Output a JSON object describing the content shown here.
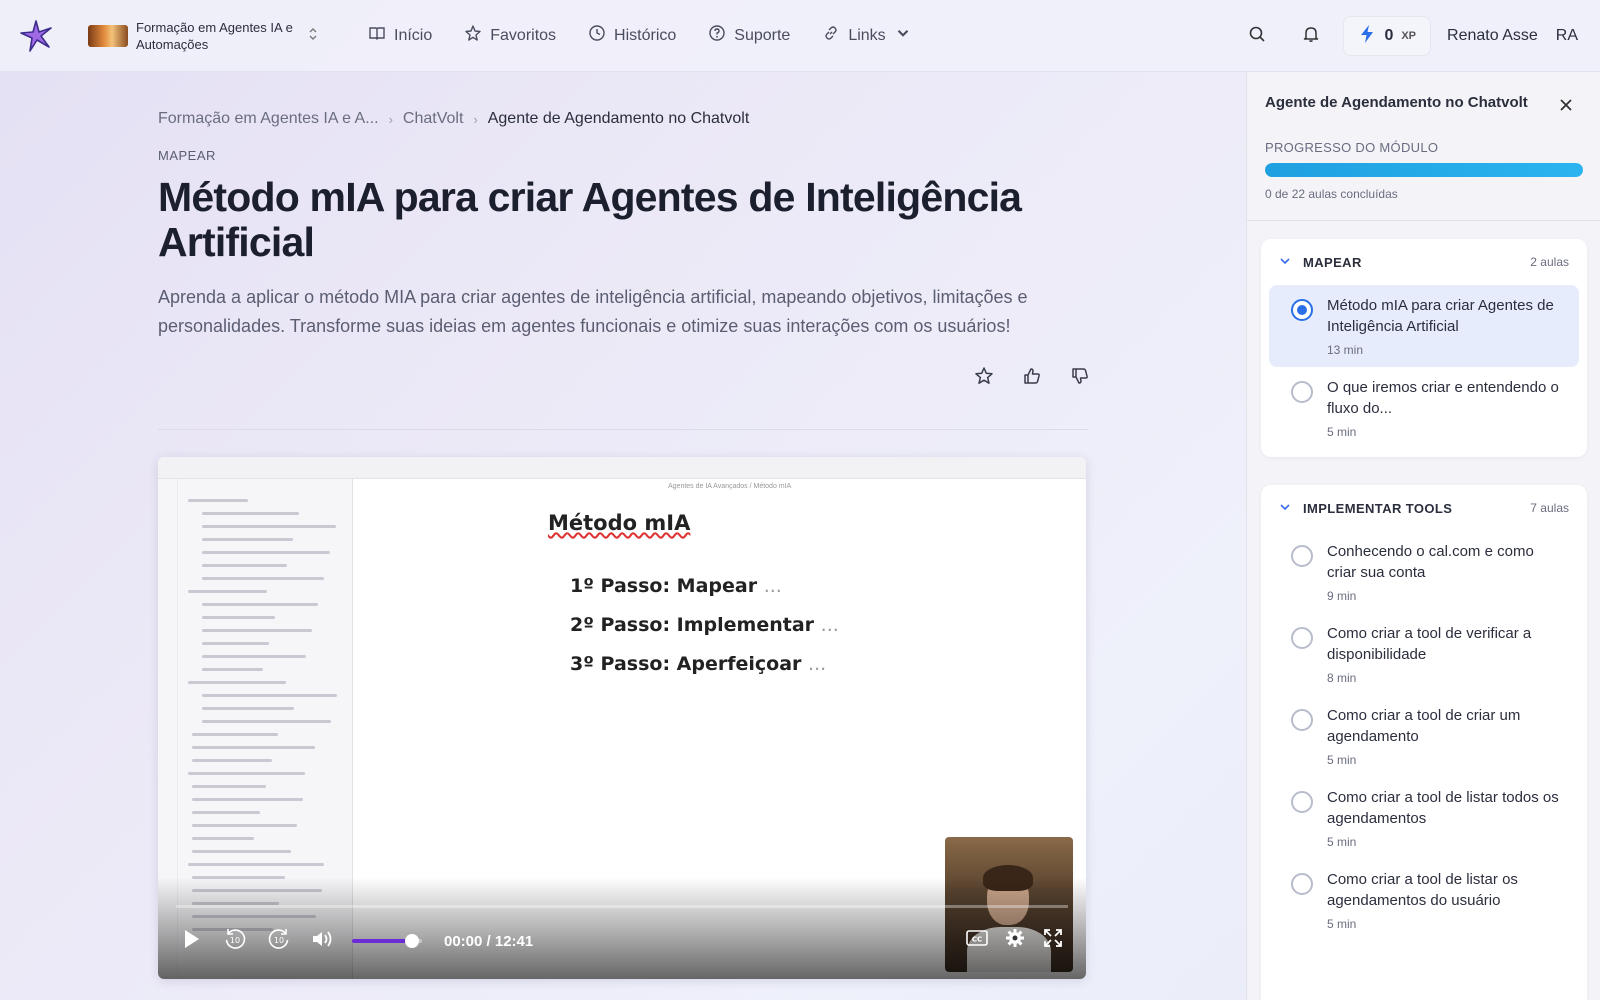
{
  "header": {
    "course_name": "Formação em Agentes IA e Automações",
    "nav": [
      {
        "label": "Início",
        "icon": "book-open-icon"
      },
      {
        "label": "Favoritos",
        "icon": "star-icon"
      },
      {
        "label": "Histórico",
        "icon": "clock-icon"
      },
      {
        "label": "Suporte",
        "icon": "help-circle-icon"
      },
      {
        "label": "Links",
        "icon": "link-icon"
      }
    ],
    "xp_value": "0",
    "xp_unit": "XP",
    "user_name": "Renato Asse",
    "user_initials": "RA"
  },
  "breadcrumb": {
    "course": "Formação em Agentes IA e A...",
    "module": "ChatVolt",
    "current": "Agente de Agendamento no Chatvolt"
  },
  "lesson": {
    "section": "MAPEAR",
    "title": "Método mIA para criar Agentes de Inteligência Artificial",
    "description": "Aprenda a aplicar o método MIA para criar agentes de inteligência artificial, mapeando objetivos, limitações e personalidades. Transforme suas ideias em agentes funcionais e otimize suas interações com os usuários!"
  },
  "video": {
    "slide_path": "Agentes de IA Avançados / Método mIA",
    "slide_heading": "Método mIA",
    "slide_steps": [
      "1º Passo: Mapear",
      "2º Passo: Implementar",
      "3º Passo: Aperfeiçoar"
    ],
    "time": "00:00 / 12:41",
    "volume_fraction": 0.85,
    "played_fraction": 0
  },
  "panel": {
    "title": "Agente de Agendamento no Chatvolt",
    "progress_label": "PROGRESSO DO MÓDULO",
    "progress_fraction": 1.0,
    "progress_count": "0 de 22 aulas concluídas",
    "modules": [
      {
        "title": "MAPEAR",
        "count": "2 aulas",
        "lessons": [
          {
            "title": "Método mIA para criar Agentes de Inteligência Artificial",
            "duration": "13 min",
            "active": true
          },
          {
            "title": "O que iremos criar e entendendo o fluxo do...",
            "duration": "5 min",
            "active": false
          }
        ]
      },
      {
        "title": "IMPLEMENTAR TOOLS",
        "count": "7 aulas",
        "lessons": [
          {
            "title": "Conhecendo o cal.com e como criar sua conta",
            "duration": "9 min",
            "active": false
          },
          {
            "title": "Como criar a tool de verificar a disponibilidade",
            "duration": "8 min",
            "active": false
          },
          {
            "title": "Como criar a tool de criar um agendamento",
            "duration": "5 min",
            "active": false
          },
          {
            "title": "Como criar a tool de listar todos os agendamentos",
            "duration": "5 min",
            "active": false
          },
          {
            "title": "Como criar a tool de listar os agendamentos do usuário",
            "duration": "5 min",
            "active": false
          }
        ]
      }
    ]
  },
  "colors": {
    "accent": "#2b6fe8",
    "progress": "#1fa0e0",
    "volume": "#6b2bd6"
  }
}
